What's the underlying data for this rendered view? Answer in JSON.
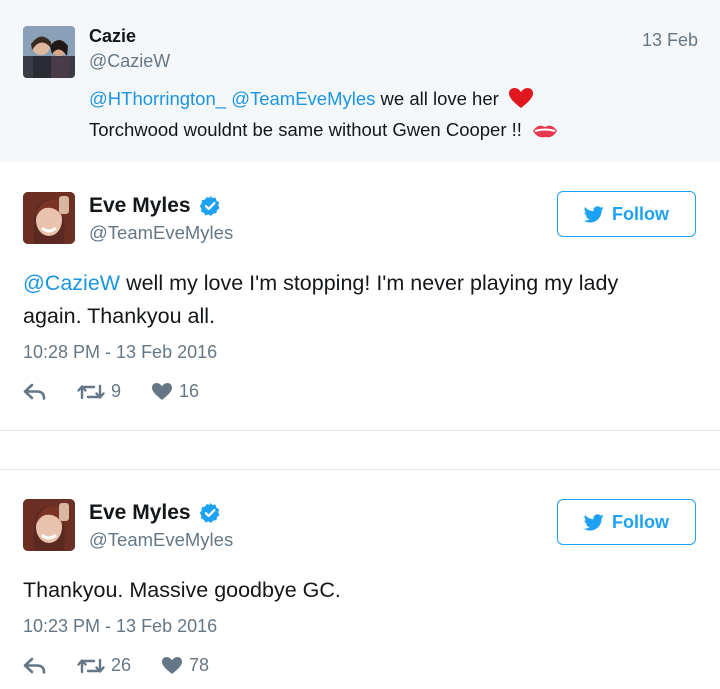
{
  "parent_tweet": {
    "name": "Cazie",
    "handle": "@CazieW",
    "date": "13 Feb",
    "mention1": "@HThorrington_",
    "mention2": "@TeamEveMyles",
    "text_line1": " we all love her",
    "text_line2": "Torchwood wouldnt be same without Gwen Cooper !!",
    "emoji1": "red-heart-icon",
    "emoji2": "kiss-mark-icon"
  },
  "tweets": [
    {
      "name": "Eve Myles",
      "handle": "@TeamEveMyles",
      "follow_label": "Follow",
      "mention": "@CazieW",
      "text_line1_rest": " well my love I'm stopping! I'm never playing my lady",
      "text_line2": "again. Thankyou all.",
      "timestamp": "10:28 PM - 13 Feb 2016",
      "retweets": "9",
      "likes": "16"
    },
    {
      "name": "Eve Myles",
      "handle": "@TeamEveMyles",
      "follow_label": "Follow",
      "text": "Thankyou. Massive goodbye GC.",
      "timestamp": "10:23 PM - 13 Feb 2016",
      "retweets": "26",
      "likes": "78"
    }
  ],
  "colors": {
    "link": "#1b95e0",
    "follow": "#1da1f2",
    "muted": "#657786",
    "parent_bg": "#f5f8fa"
  }
}
